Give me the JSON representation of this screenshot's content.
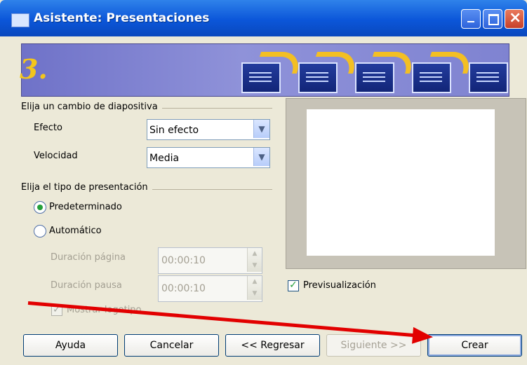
{
  "window": {
    "title": "Asistente: Presentaciones",
    "icons": [
      "app-icon",
      "minimize-icon",
      "maximize-icon",
      "close-icon"
    ]
  },
  "banner": {
    "step": "3."
  },
  "transition_group": {
    "title": "Elija un cambio de diapositiva",
    "effect_label": "Efecto",
    "effect_value": "Sin efecto",
    "speed_label": "Velocidad",
    "speed_value": "Media"
  },
  "presentation_type_group": {
    "title": "Elija el tipo de presentación",
    "default_label": "Predeterminado",
    "automatic_label": "Automático",
    "page_duration_label": "Duración página",
    "page_duration_value": "00:00:10",
    "pause_duration_label": "Duración pausa",
    "pause_duration_value": "00:00:10",
    "show_logo_label": "Mostrar logotipo"
  },
  "preview": {
    "checkbox_label": "Previsualización"
  },
  "buttons": {
    "help": "Ayuda",
    "cancel": "Cancelar",
    "back": "<< Regresar",
    "next": "Siguiente >>",
    "create": "Crear"
  },
  "colors": {
    "titlebar": "#0b56d9",
    "banner": "#8f92d9",
    "annotation_arrow": "#e20000",
    "selected_radio": "#24a03a"
  }
}
